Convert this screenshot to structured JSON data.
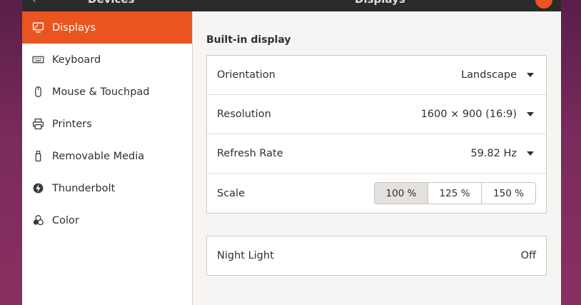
{
  "header": {
    "back_glyph": "‹",
    "sidebar_title": "Devices",
    "main_title": "Displays"
  },
  "sidebar": {
    "items": [
      {
        "label": "Displays",
        "icon": "display-icon",
        "active": true
      },
      {
        "label": "Keyboard",
        "icon": "keyboard-icon",
        "active": false
      },
      {
        "label": "Mouse & Touchpad",
        "icon": "mouse-icon",
        "active": false
      },
      {
        "label": "Printers",
        "icon": "printer-icon",
        "active": false
      },
      {
        "label": "Removable Media",
        "icon": "removable-media-icon",
        "active": false
      },
      {
        "label": "Thunderbolt",
        "icon": "thunderbolt-icon",
        "active": false
      },
      {
        "label": "Color",
        "icon": "color-icon",
        "active": false
      }
    ]
  },
  "main": {
    "section_title": "Built-in display",
    "rows": {
      "orientation": {
        "label": "Orientation",
        "value": "Landscape"
      },
      "resolution": {
        "label": "Resolution",
        "value": "1600 × 900 (16:9)"
      },
      "refresh_rate": {
        "label": "Refresh Rate",
        "value": "59.82 Hz"
      },
      "scale": {
        "label": "Scale",
        "options": [
          "100 %",
          "125 %",
          "150 %"
        ],
        "selected": "100 %"
      }
    },
    "night_light": {
      "label": "Night Light",
      "value": "Off"
    }
  },
  "colors": {
    "accent": "#e95420",
    "headerbar": "#2b2b2b",
    "window_bg": "#f6f5f4"
  }
}
